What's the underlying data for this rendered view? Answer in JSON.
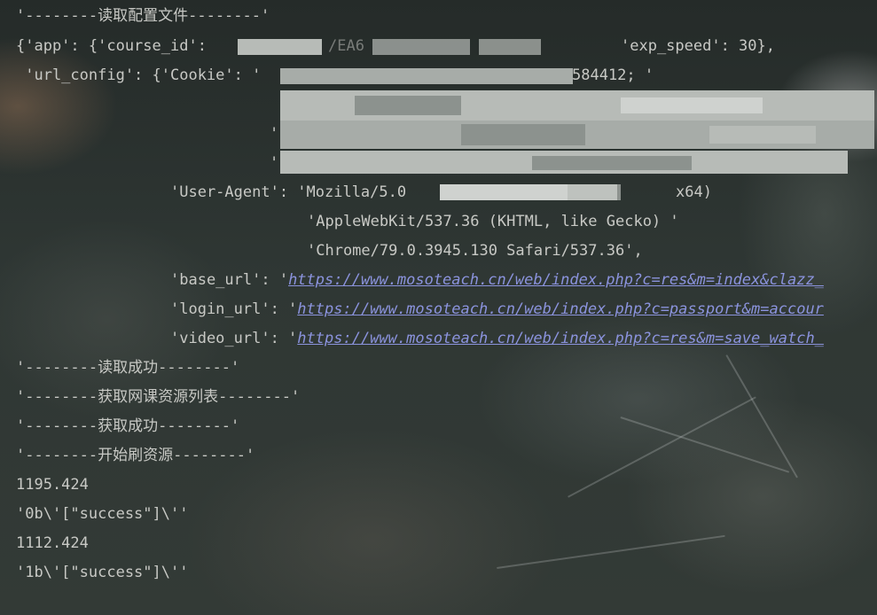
{
  "console": {
    "lines": {
      "l0": "'--------读取配置文件--------'",
      "l1a": "{'app': {'course_id': ",
      "l1b": "'exp_speed': 30},",
      "l1c": "/EA6",
      "l2a": " 'url_config': {'Cookie': '",
      "l2b": "584412; '",
      "l5": "'",
      "l6a": "'User-Agent': 'Mozilla/5.0 ",
      "l6b": "x64) ",
      "l7": "'AppleWebKit/537.36 (KHTML, like Gecko) '",
      "l8": "'Chrome/79.0.3945.130 Safari/537.36',",
      "l9a": "'base_url': '",
      "l9b": "https://www.mosoteach.cn/web/index.php?c=res&m=index&clazz_",
      "l10a": "'login_url': '",
      "l10b": "https://www.mosoteach.cn/web/index.php?c=passport&m=accour",
      "l11a": "'video_url': '",
      "l11b": "https://www.mosoteach.cn/web/index.php?c=res&m=save_watch_",
      "l12": "'--------读取成功--------'",
      "l13": "'--------获取网课资源列表--------'",
      "l14": "'--------获取成功--------'",
      "l15": "'--------开始刷资源--------'",
      "l16": "1195.424",
      "l17": "'0b\\'[\"success\"]\\''",
      "l18": "1112.424",
      "l19": "'1b\\'[\"success\"]\\''"
    }
  },
  "colors": {
    "text": "#c8c9c5",
    "link": "#8b93dd",
    "redaction": "#9aa09c"
  }
}
